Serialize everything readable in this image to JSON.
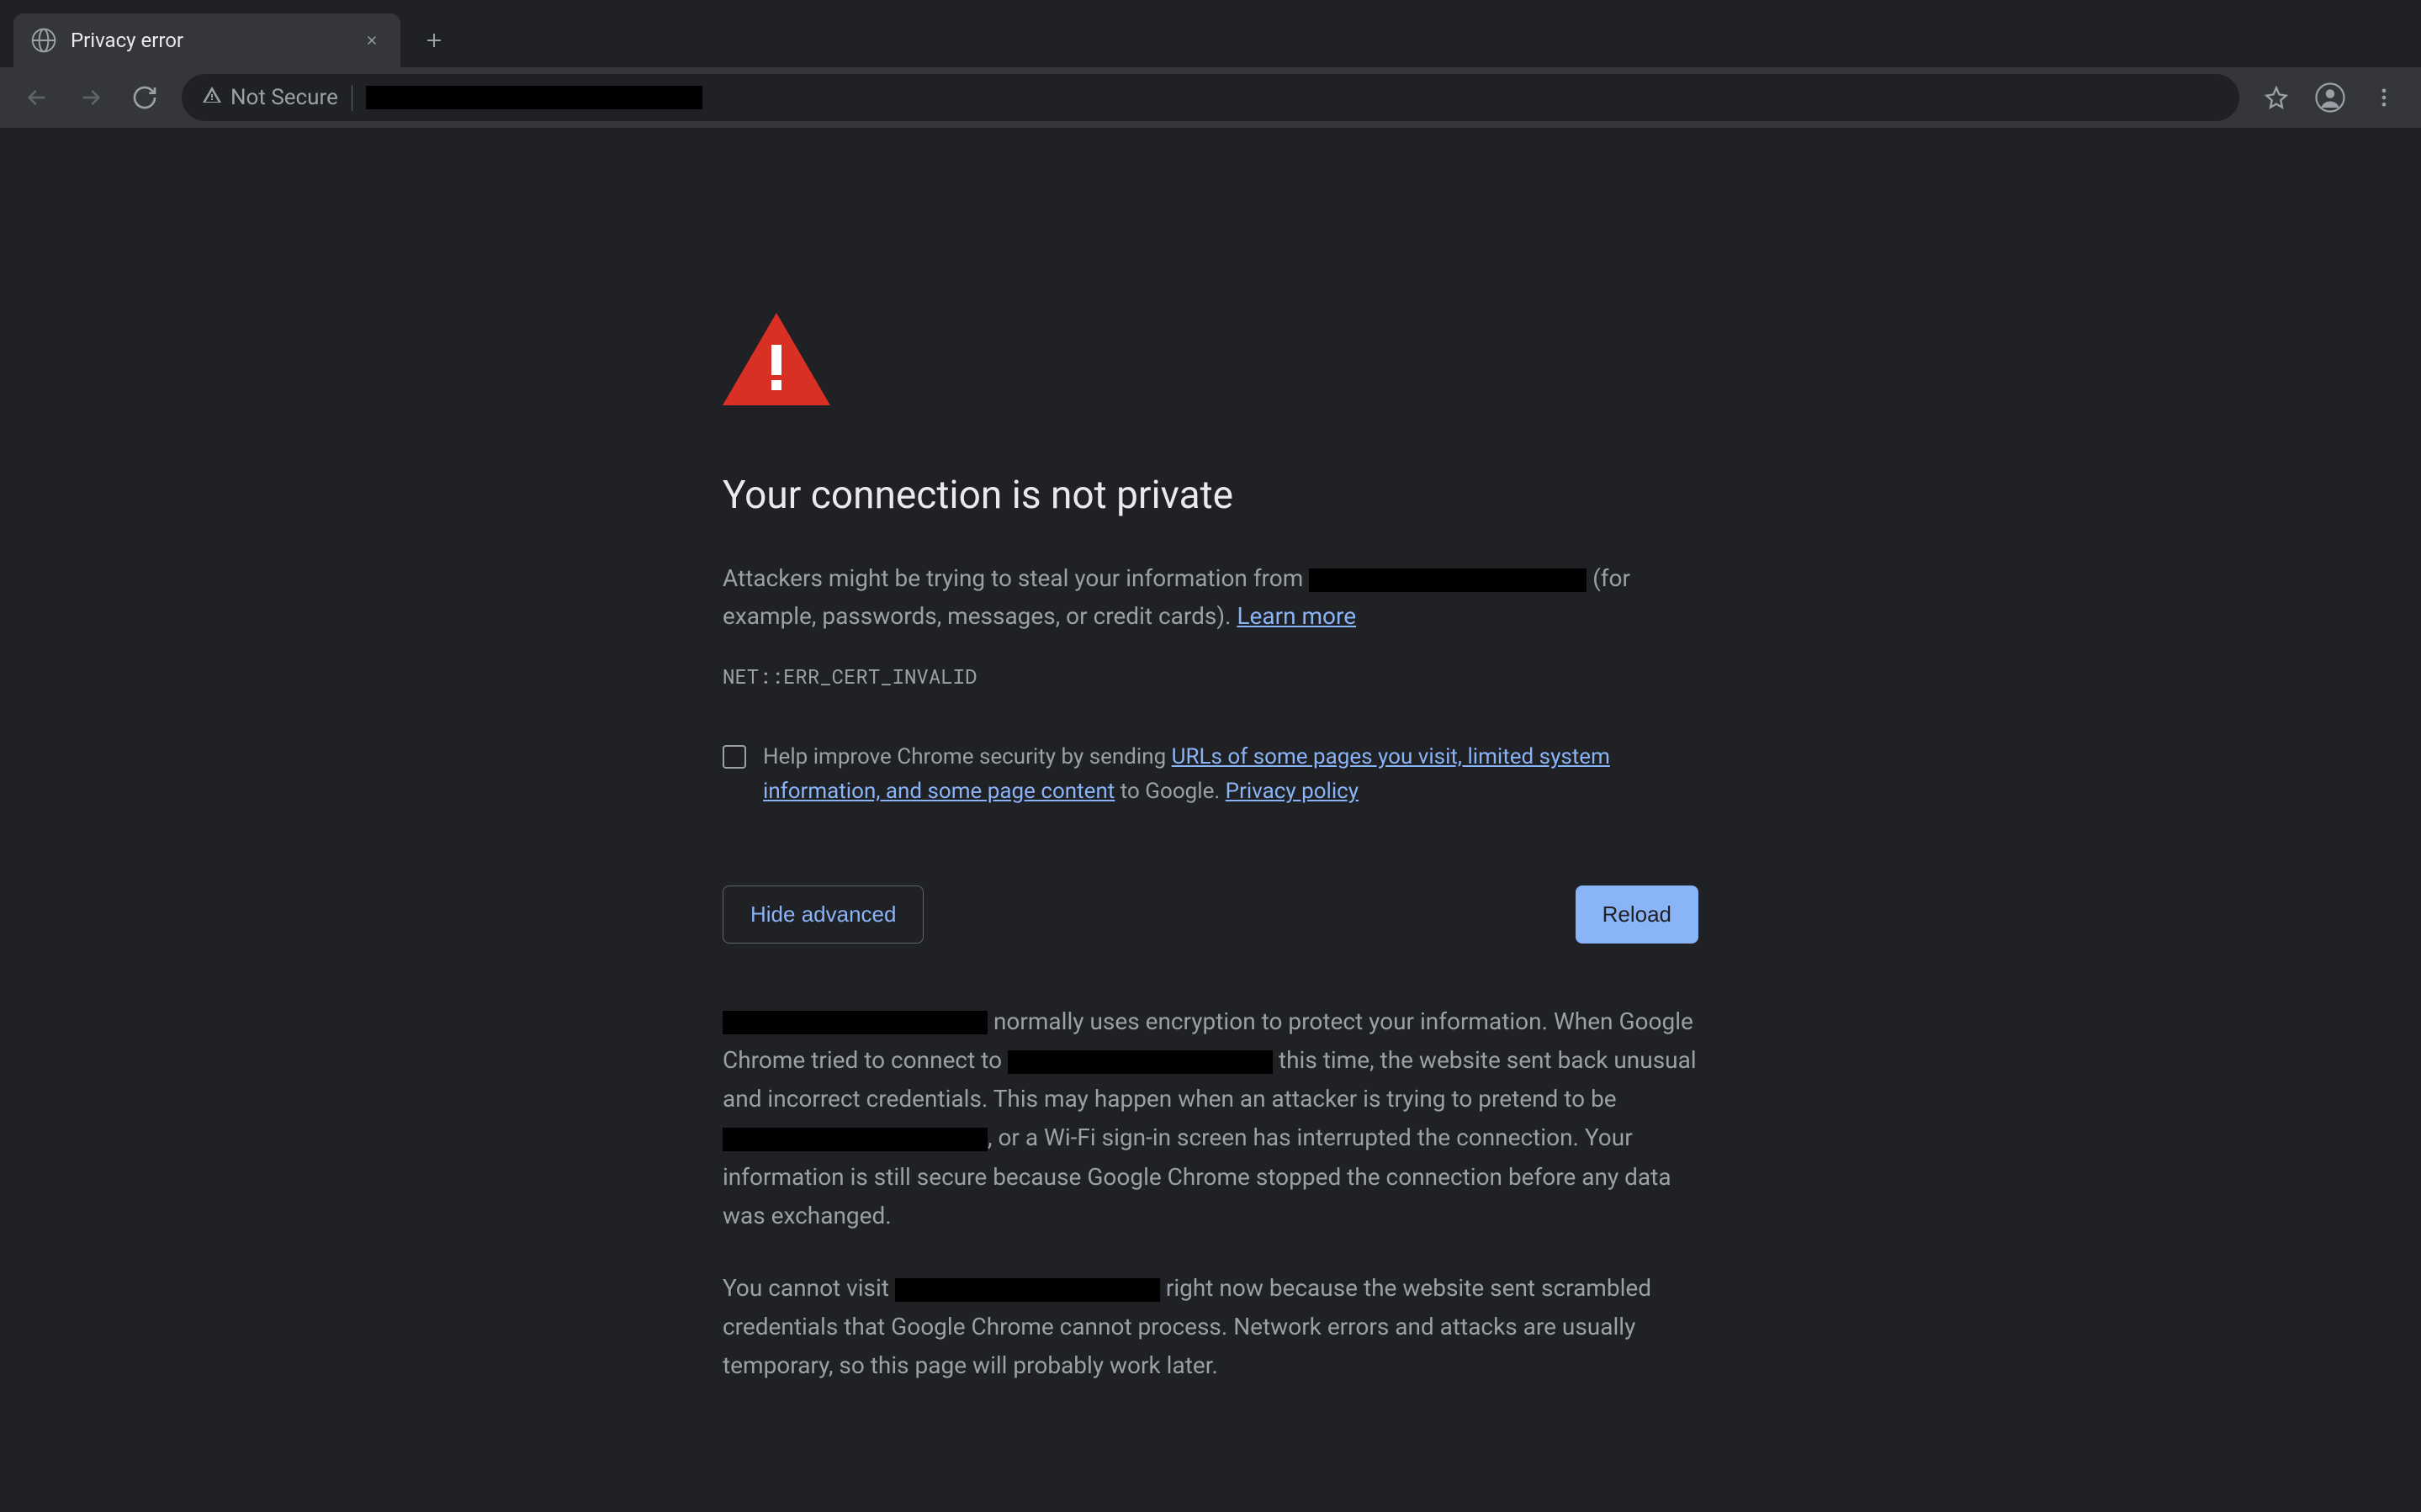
{
  "tab": {
    "title": "Privacy error"
  },
  "toolbar": {
    "security_label": "Not Secure"
  },
  "page": {
    "heading": "Your connection is not private",
    "p1_pre": "Attackers might be trying to steal your information from ",
    "p1_post": " (for example, passwords, messages, or credit cards). ",
    "learn_more": "Learn more",
    "error_code": "NET::ERR_CERT_INVALID",
    "opt_in_pre": "Help improve Chrome security by sending ",
    "opt_in_link": "URLs of some pages you visit, limited system information, and some page content",
    "opt_in_mid": " to Google. ",
    "privacy_link": "Privacy policy",
    "hide_advanced": "Hide advanced",
    "reload": "Reload",
    "d1_a": " normally uses encryption to protect your information. When Google Chrome tried to connect to ",
    "d1_b": " this time, the website sent back unusual and incorrect credentials. This may happen when an attacker is trying to pretend to be ",
    "d1_c": ", or a Wi-Fi sign-in screen has interrupted the connection. Your information is still secure because Google Chrome stopped the connection before any data was exchanged.",
    "d2_a": "You cannot visit ",
    "d2_b": " right now because the website sent scrambled credentials that Google Chrome cannot process. Network errors and attacks are usually temporary, so this page will probably work later."
  }
}
